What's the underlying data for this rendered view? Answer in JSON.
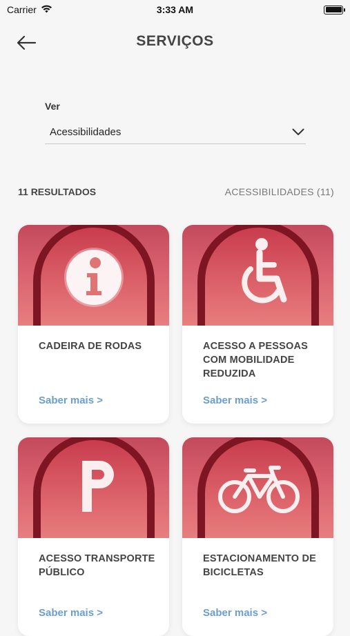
{
  "status_bar": {
    "carrier": "Carrier",
    "time": "3:33 AM"
  },
  "header": {
    "title": "SERVIÇOS",
    "back_icon": "arrow-left-icon"
  },
  "filter": {
    "label": "Ver",
    "value": "Acessibilidades",
    "dropdown_icon": "chevron-down-icon"
  },
  "results": {
    "count_label": "11 RESULTADOS",
    "filter_label": "ACESSIBILIDADES (11)"
  },
  "colors": {
    "accent": "#d9616f",
    "arch_dark": "#7d1622",
    "link": "#6a9ed0"
  },
  "cards": [
    {
      "title": "CADEIRA DE RODAS",
      "link": "Saber mais >",
      "icon": "info-icon"
    },
    {
      "title": "ACESSO A PESSOAS COM MOBILIDADE REDUZIDA",
      "link": "Saber mais >",
      "icon": "wheelchair-icon"
    },
    {
      "title": "ACESSO TRANSPORTE PÚBLICO",
      "link": "Saber mais >",
      "icon": "parking-icon"
    },
    {
      "title": "ESTACIONAMENTO DE BICICLETAS",
      "link": "Saber mais >",
      "icon": "bicycle-icon"
    }
  ]
}
